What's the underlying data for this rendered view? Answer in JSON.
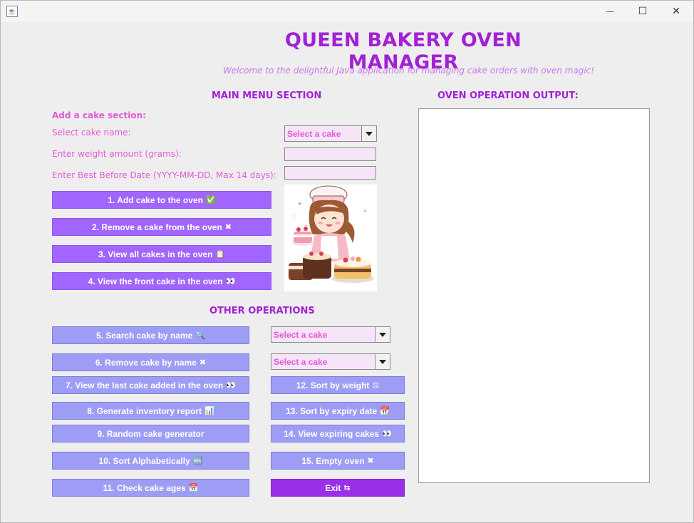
{
  "window": {
    "minimize_glyph": "—",
    "maximize_glyph": "☐",
    "close_glyph": "✕"
  },
  "header": {
    "title": "QUEEN BAKERY OVEN MANAGER",
    "welcome": "Welcome to the delightful Java application for managing cake orders with oven magic!"
  },
  "main_menu": {
    "heading": "MAIN MENU SECTION",
    "add_section_label": "Add a cake section:",
    "cake_name_label": "Select cake name:",
    "cake_name_value": "Select a cake",
    "weight_label": "Enter weight amount (grams):",
    "weight_value": "",
    "best_before_label": "Enter Best Before Date (YYYY-MM-DD, Max 14 days):",
    "best_before_value": "",
    "buttons": {
      "add": {
        "label": "1. Add cake to the oven",
        "icon": "✅"
      },
      "remove": {
        "label": "2. Remove a cake from the oven",
        "icon": "✖"
      },
      "view_all": {
        "label": "3. View all cakes in the oven",
        "icon": "📋"
      },
      "view_front": {
        "label": "4. View the front cake in the oven",
        "icon": "👀"
      }
    }
  },
  "other_ops": {
    "heading": "OTHER OPERATIONS",
    "search_combo": "Select a cake",
    "remove_combo": "Select a cake",
    "buttons": {
      "b5": {
        "label": "5. Search cake by name",
        "icon": "🔍"
      },
      "b6": {
        "label": "6. Remove cake by name",
        "icon": "✖"
      },
      "b7": {
        "label": "7. View the last cake added in the oven",
        "icon": "👀"
      },
      "b8": {
        "label": "8. Generate inventory report",
        "icon": "📊"
      },
      "b9": {
        "label": "9. Random cake generator",
        "icon": ""
      },
      "b10": {
        "label": "10. Sort Alphabetically",
        "icon": "🔤"
      },
      "b11": {
        "label": "11. Check cake ages",
        "icon": "📅"
      },
      "b12": {
        "label": "12. Sort by weight",
        "icon": "⚖"
      },
      "b13": {
        "label": "13. Sort by expiry date",
        "icon": "📆"
      },
      "b14": {
        "label": "14. View expiring cakes",
        "icon": "👀"
      },
      "b15": {
        "label": "15. Empty oven",
        "icon": "✖"
      },
      "exit": {
        "label": "Exit",
        "icon": "⇆"
      }
    }
  },
  "output": {
    "heading": "OVEN OPERATION OUTPUT:",
    "text": ""
  },
  "colors": {
    "title": "#a221d6",
    "label": "#e25ad9",
    "main_button": "#a166ff",
    "other_button": "#9e9df6",
    "exit_button": "#9a2fea"
  }
}
